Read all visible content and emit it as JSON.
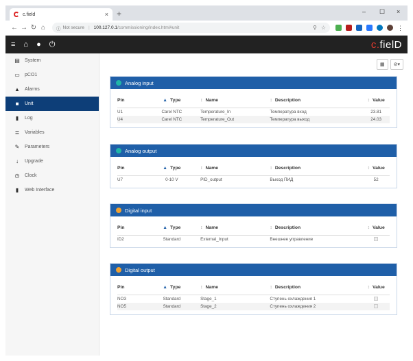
{
  "browser": {
    "tab_title": "c.field",
    "tab_close": "×",
    "new_tab": "+",
    "minimize": "–",
    "maximize": "☐",
    "close": "×",
    "not_secure": "Not secure",
    "url_host": "100.127.0.1",
    "url_path": "/commissioning/index.html#unit"
  },
  "navbar": {
    "brand_c": "c.",
    "brand_rest": "fielD"
  },
  "sidebar": {
    "items": [
      {
        "label": "System",
        "icon": "server-icon"
      },
      {
        "label": "pCO1",
        "icon": "monitor-icon"
      },
      {
        "label": "Alarms",
        "icon": "bell-icon"
      },
      {
        "label": "Unit",
        "icon": "truck-icon"
      },
      {
        "label": "Log",
        "icon": "book-icon"
      },
      {
        "label": "Variables",
        "icon": "database-icon"
      },
      {
        "label": "Parameters",
        "icon": "wrench-icon"
      },
      {
        "label": "Upgrade",
        "icon": "download-icon"
      },
      {
        "label": "Clock",
        "icon": "clock-icon"
      },
      {
        "label": "Web Interface",
        "icon": "bookmark-icon"
      }
    ],
    "active_index": 3
  },
  "toolbar": {
    "view_label": "▦",
    "menu_label": "⊘▾"
  },
  "columns": {
    "pin": "Pin",
    "type": "Type",
    "name": "Name",
    "description": "Description",
    "value": "Value"
  },
  "cards": [
    {
      "title": "Analog input",
      "dot_color": "#1fb5a8",
      "rows": [
        {
          "pin": "U1",
          "type": "Carel NTC",
          "name": "Temperature_In",
          "description": "Температура вход",
          "value": "23.81"
        },
        {
          "pin": "U4",
          "type": "Carel NTC",
          "name": "Temperature_Out",
          "description": "Температура выход",
          "value": "24.03"
        }
      ]
    },
    {
      "title": "Analog output",
      "dot_color": "#1fb5a8",
      "rows": [
        {
          "pin": "U7",
          "type": "0-10 V",
          "name": "PID_output",
          "description": "Выход ПИД",
          "value": "52"
        }
      ]
    },
    {
      "title": "Digital input",
      "dot_color": "#f0a030",
      "rows": [
        {
          "pin": "ID2",
          "type": "Standard",
          "name": "External_Input",
          "description": "Внешнее управление",
          "value": "checkbox"
        }
      ]
    },
    {
      "title": "Digital output",
      "dot_color": "#f0a030",
      "rows": [
        {
          "pin": "NO3",
          "type": "Standard",
          "name": "Stage_1",
          "description": "Ступень охлаждения 1",
          "value": "checkbox"
        },
        {
          "pin": "NO5",
          "type": "Standard",
          "name": "Stage_2",
          "description": "Ступень охлаждения 2",
          "value": "checkbox"
        }
      ]
    }
  ]
}
